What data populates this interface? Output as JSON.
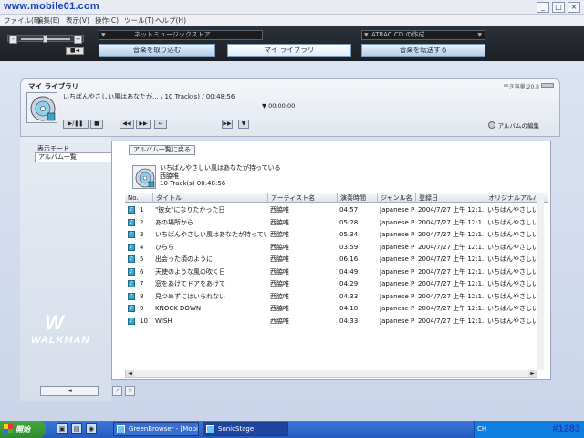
{
  "watermark": "www.mobile01.com",
  "watermark_bottom": "#1283",
  "window": {
    "minimize": "_",
    "maximize": "□",
    "close": "×"
  },
  "menu": [
    "ファイル(F)",
    "編集(E)",
    "表示(V)",
    "操作(C)",
    "ツール(T)",
    "ヘルプ(H)"
  ],
  "header": {
    "volume_minus": "-",
    "volume_plus": "+",
    "mute_label": "■◄",
    "store_left": "ネットミュージックストア",
    "store_right": "ATRAC CD の作成",
    "buttons": [
      {
        "label": "音楽を取り込む"
      },
      {
        "label": "マイ ライブラリ"
      },
      {
        "label": "音楽を転送する"
      }
    ]
  },
  "panel": {
    "title": "マイ ライブラリ",
    "capacity": "空き容量:20.8",
    "track_line": "いちばんやさしい風はあなたが... / 10 Track(s) / 00:48:56",
    "time_display": "▼ 00:00:00",
    "album_edit": "アルバムの編集",
    "controls": [
      "▶/❚❚",
      "■",
      "◀◀",
      "▶▶",
      "↔",
      "▶▶",
      "▼"
    ]
  },
  "left": {
    "view_label": "表示モード",
    "view_value": "アルバム一覧",
    "logo_text": "WALKMAN",
    "back_arrow": "◄",
    "ok_mark": "✓",
    "cancel_mark": "×"
  },
  "content": {
    "back_button": "アルバム一覧に戻る",
    "album_title": "いちばんやさしい風はあなたが持っている",
    "album_artist": "西脇唯",
    "album_meta": "10 Track(s)   00:48:56",
    "columns": [
      "No.",
      "タイトル",
      "アーティスト名",
      "演奏時間",
      "ジャンル名",
      "登録日",
      "オリジナルアルバム"
    ],
    "rows": [
      {
        "no": "1",
        "title": "\"彼女\"になりたかった日",
        "artist": "西脇唯",
        "time": "04:57",
        "genre": "Japanese P...",
        "date": "2004/7/27 上午 12:1...",
        "album": "いちばんやさしい風..."
      },
      {
        "no": "2",
        "title": "あの場所から",
        "artist": "西脇唯",
        "time": "05:28",
        "genre": "Japanese P...",
        "date": "2004/7/27 上午 12:1...",
        "album": "いちばんやさしい風..."
      },
      {
        "no": "3",
        "title": "いちばんやさしい風はあなたが持っている",
        "artist": "西脇唯",
        "time": "05:34",
        "genre": "Japanese P...",
        "date": "2004/7/27 上午 12:1...",
        "album": "いちばんやさしい風..."
      },
      {
        "no": "4",
        "title": "ひらら",
        "artist": "西脇唯",
        "time": "03:59",
        "genre": "Japanese P...",
        "date": "2004/7/27 上午 12:1...",
        "album": "いちばんやさしい風..."
      },
      {
        "no": "5",
        "title": "出会った頃のように",
        "artist": "西脇唯",
        "time": "06:16",
        "genre": "Japanese P...",
        "date": "2004/7/27 上午 12:1...",
        "album": "いちばんやさしい風..."
      },
      {
        "no": "6",
        "title": "天使のような風の吹く日",
        "artist": "西脇唯",
        "time": "04:49",
        "genre": "Japanese P...",
        "date": "2004/7/27 上午 12:1...",
        "album": "いちばんやさしい風..."
      },
      {
        "no": "7",
        "title": "窓をあけてドアをあけて",
        "artist": "西脇唯",
        "time": "04:29",
        "genre": "Japanese P...",
        "date": "2004/7/27 上午 12:1...",
        "album": "いちばんやさしい風..."
      },
      {
        "no": "8",
        "title": "見つめずにはいられない",
        "artist": "西脇唯",
        "time": "04:33",
        "genre": "Japanese P...",
        "date": "2004/7/27 上午 12:1...",
        "album": "いちばんやさしい風..."
      },
      {
        "no": "9",
        "title": "KNOCK DOWN",
        "artist": "西脇唯",
        "time": "04:18",
        "genre": "Japanese P...",
        "date": "2004/7/27 上午 12:1...",
        "album": "いちばんやさしい風..."
      },
      {
        "no": "10",
        "title": "WISH",
        "artist": "西脇唯",
        "time": "04:33",
        "genre": "Japanese P...",
        "date": "2004/7/27 上午 12:1...",
        "album": "いちばんやさしい風..."
      }
    ]
  },
  "taskbar": {
    "start": "開始",
    "tasks": [
      {
        "label": "GreenBrowser - [Mobi..."
      },
      {
        "label": "SonicStage"
      }
    ],
    "tray_lang": "CH"
  },
  "colors": {
    "accent": "#3aa3c8",
    "header_bg": "#1c1f25",
    "taskbar": "#245bc2"
  }
}
